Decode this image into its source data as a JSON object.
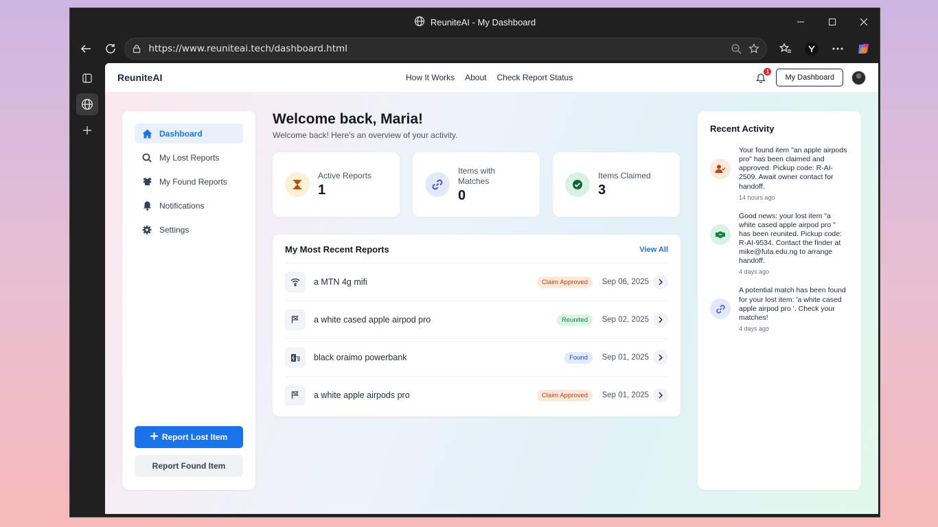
{
  "window": {
    "title": "ReuniteAI - My Dashboard"
  },
  "browser": {
    "url": "https://www.reuniteai.tech/dashboard.html"
  },
  "nav": {
    "brand": "ReuniteAI",
    "links": [
      "How It Works",
      "About",
      "Check Report Status"
    ],
    "notification_count": "1",
    "dashboard_button": "My Dashboard"
  },
  "sidebar": {
    "items": [
      {
        "label": "Dashboard",
        "icon": "home-icon"
      },
      {
        "label": "My Lost Reports",
        "icon": "search-icon"
      },
      {
        "label": "My Found Reports",
        "icon": "box-icon"
      },
      {
        "label": "Notifications",
        "icon": "bell-icon"
      },
      {
        "label": "Settings",
        "icon": "gear-icon"
      }
    ],
    "report_lost": "Report Lost Item",
    "report_found": "Report Found Item"
  },
  "main": {
    "welcome": "Welcome back, Maria!",
    "subtitle": "Welcome back! Here's an overview of your activity.",
    "stats": [
      {
        "label": "Active Reports",
        "value": "1",
        "icon": "hourglass-icon",
        "color": "#b45309",
        "bg": "#fdf0d5"
      },
      {
        "label": "Items with Matches",
        "value": "0",
        "icon": "link-icon",
        "color": "#3b5bdb",
        "bg": "#e3e9fb"
      },
      {
        "label": "Items Claimed",
        "value": "3",
        "icon": "check-circle-icon",
        "color": "#15803d",
        "bg": "#d8f3e3"
      }
    ],
    "recent": {
      "title": "My Most Recent Reports",
      "view_all": "View All",
      "rows": [
        {
          "name": "a MTN 4g mifi",
          "status": "Claim Approved",
          "kind": "claim",
          "date": "Sep 06, 2025",
          "icon": "wifi-icon"
        },
        {
          "name": "a white cased apple airpod pro",
          "status": "Reunited",
          "kind": "reunited",
          "date": "Sep 02, 2025",
          "icon": "flag-icon"
        },
        {
          "name": "black oraimo powerbank",
          "status": "Found",
          "kind": "found",
          "date": "Sep 01, 2025",
          "icon": "charging-icon"
        },
        {
          "name": "a white apple airpods pro",
          "status": "Claim Approved",
          "kind": "claim",
          "date": "Sep 01, 2025",
          "icon": "flag-icon"
        }
      ]
    }
  },
  "activity": {
    "title": "Recent Activity",
    "items": [
      {
        "text": "Your found item \"an apple airpods pro\" has been claimed and approved. Pickup code: R-AI-2509. Await owner contact for handoff.",
        "time": "14 hours ago",
        "icon": "user-check-icon",
        "color": "#c2410c",
        "bg": "#fde9dc"
      },
      {
        "text": "Good news: your lost item \"a white cased apple airpod pro \" has been reunited. Pickup code: R-AI-9534. Contact the finder at mike@futa.edu.ng to arrange handoff.",
        "time": "4 days ago",
        "icon": "handshake-icon",
        "color": "#15803d",
        "bg": "#d8f3e3"
      },
      {
        "text": "A potential match has been found for your lost item: 'a white cased apple airpod pro '. Check your matches!",
        "time": "4 days ago",
        "icon": "link-icon",
        "color": "#3b5bdb",
        "bg": "#e3e9fb"
      }
    ]
  }
}
